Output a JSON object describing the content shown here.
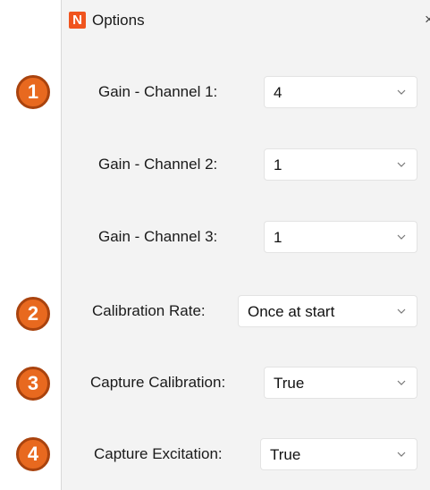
{
  "window": {
    "title": "Options",
    "logo_letter": "N",
    "close_symbol": "×"
  },
  "badges": [
    "1",
    "2",
    "3",
    "4"
  ],
  "options": {
    "gain_channel_1": {
      "label": "Gain - Channel 1:",
      "value": "4"
    },
    "gain_channel_2": {
      "label": "Gain - Channel 2:",
      "value": "1"
    },
    "gain_channel_3": {
      "label": "Gain - Channel 3:",
      "value": "1"
    },
    "calibration_rate": {
      "label": "Calibration Rate:",
      "value": "Once at start"
    },
    "capture_calibration": {
      "label": "Capture Calibration:",
      "value": "True"
    },
    "capture_excitation": {
      "label": "Capture Excitation:",
      "value": "True"
    }
  },
  "colors": {
    "badge_fill": "#e8691f",
    "badge_border": "#a9430e",
    "logo": "#f0541e",
    "dialog_background": "#f3f3f3"
  }
}
